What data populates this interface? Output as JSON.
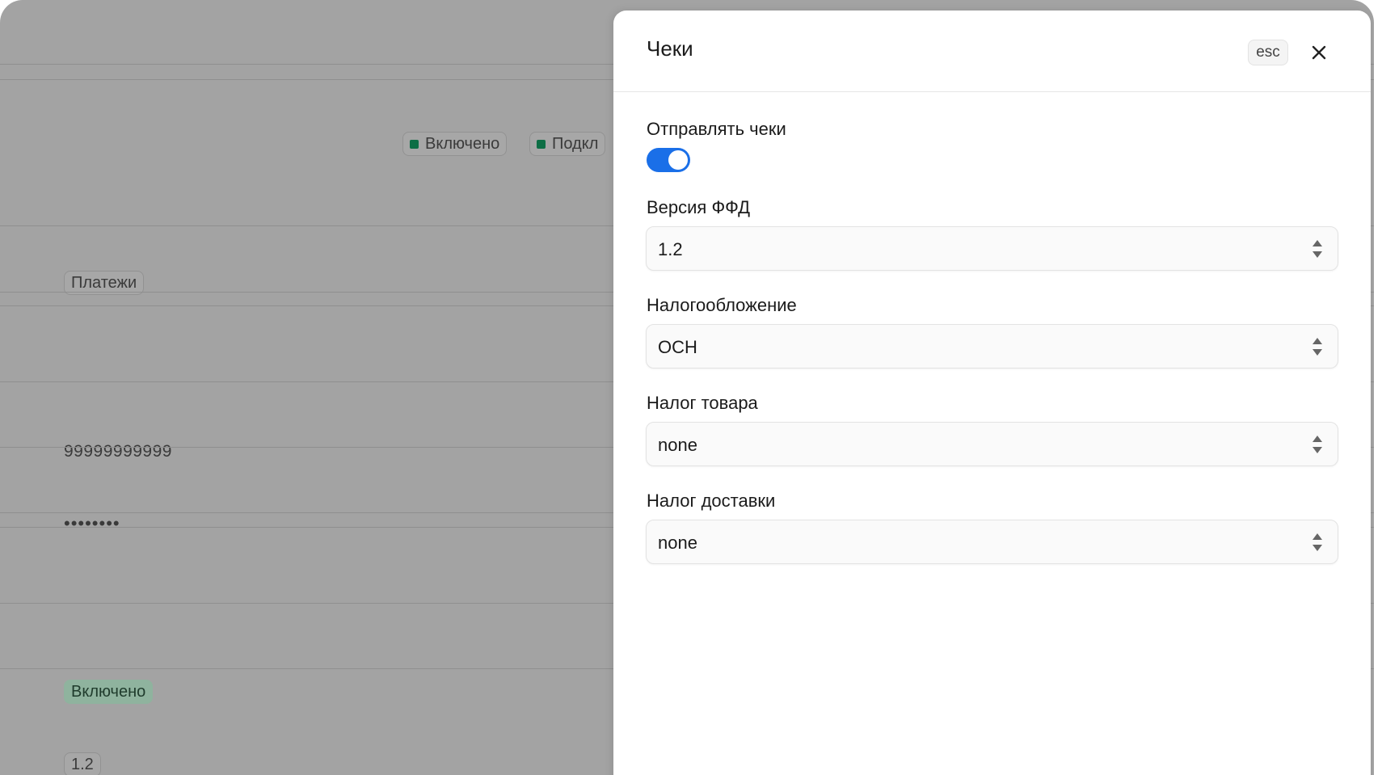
{
  "background": {
    "status_badges": [
      {
        "label": "Включено",
        "dot_color": "#0d6e45"
      },
      {
        "label": "Подкл",
        "dot_color": "#0d6e45"
      }
    ],
    "payments_badge": "Платежи",
    "inn_value": "99999999999",
    "password_mask": "••••••••",
    "enabled_badge": "Включено",
    "version_badge": "1.2"
  },
  "drawer": {
    "title": "Чеки",
    "esc_label": "esc",
    "close_icon": "close-icon",
    "send_receipts": {
      "label": "Отправлять чеки",
      "enabled": true
    },
    "fields": [
      {
        "label": "Версия ФФД",
        "value": "1.2"
      },
      {
        "label": "Налогообложение",
        "value": "ОСН"
      },
      {
        "label": "Налог товара",
        "value": "none"
      },
      {
        "label": "Налог доставки",
        "value": "none"
      }
    ]
  },
  "colors": {
    "accent": "#1a6fe8",
    "status_green": "#0d6e45",
    "overlay": "#a3a3a3"
  }
}
